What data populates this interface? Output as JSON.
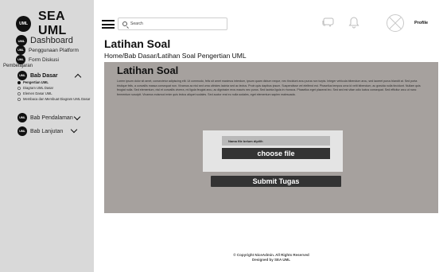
{
  "brand": {
    "logo_text": "UML",
    "name": "SEA UML"
  },
  "sidebar": {
    "items": [
      {
        "label": "Dashboard",
        "logo": "UML"
      },
      {
        "label": "Penggunaan Platform",
        "logo": "UML"
      },
      {
        "label": "Form Diskusi",
        "logo": "UML"
      }
    ],
    "section_label": "Pembelajaran",
    "groups": [
      {
        "label": "Bab Dasar",
        "logo": "UML",
        "expanded": true,
        "children": [
          {
            "label": "Pengertian UML",
            "active": true
          },
          {
            "label": "Diagram UML Dasar",
            "active": false
          },
          {
            "label": "Elemen Dasar UML",
            "active": false
          },
          {
            "label": "Membaca dan Membuat Diagram UML Dasar",
            "active": false
          }
        ]
      },
      {
        "label": "Bab Pendalaman",
        "logo": "UML",
        "expanded": false
      },
      {
        "label": "Bab Lanjutan",
        "logo": "UML",
        "expanded": false
      }
    ]
  },
  "topbar": {
    "search_placeholder": "Search",
    "icons": [
      "chat-icon",
      "bell-icon"
    ],
    "profile_label": "Profile"
  },
  "page": {
    "title": "Latihan Soal",
    "breadcrumb": "Home/Bab Dasar/Latihan Soal Pengertian UML"
  },
  "panel": {
    "title": "Latihan Soal",
    "paragraph": "Lorem ipsum dolor sit amet, consectetur adipiscing elit. Ut commodo, felis sit amet maximus interdum, ipsum quam dictum neque, nec tincidunt arcu purus non turpis. Integer vehicula bibendum arcu, sed laoreet purus blandit at. Sed porta tristique felis, a convallis massa consequat non. Vivamus ac nisl sed urna ultricies lacinia sed ac lectus. Proin quis dapibus ipsum. Suspendisse vel eleifend est. Phasellus tempus urna id velit bibendum, ac gravida nulla tincidunt. Nullam quis feugiat nulla. Sed elementum, nisl et convallis viverra, mi ligula feugiat arcu, ac dignissim eros mauris nec purus. Sed lacinia ligula in rhoncus. Phasellus eget placerat leo. Sed sed est vitae odio luctus consequat. Sed efficitur arcu ut nunc fermentum suscipit. Vivamus euismod enim quis lectus aliquet sodales. Sed auctor erat eu nulla sodales, eget elementum sapien malesuada.",
    "file_name_label": "Nama file belum dipilih",
    "choose_file_label": "choose file",
    "submit_label": "Submit Tugas"
  },
  "footer": {
    "line1": "© Copyright NiceAdmin. All Rights Reserved",
    "line2": "Designed by SEA UML"
  }
}
